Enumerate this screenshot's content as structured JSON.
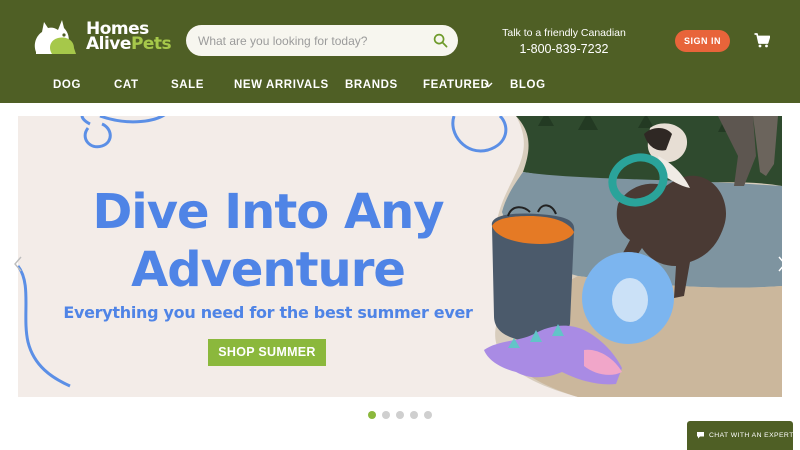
{
  "brand": {
    "name_line1": "Homes",
    "name_line2": "Alive",
    "name_line3": "Pets",
    "color_header": "#4f5f25",
    "color_accent": "#a6c84a"
  },
  "search": {
    "placeholder": "What are you looking for today?",
    "value": "",
    "icon": "search-icon"
  },
  "contact": {
    "line": "Talk to a friendly Canadian",
    "phone": "1-800-839-7232"
  },
  "account": {
    "signin_label": "SIGN IN",
    "signin_color": "#e8643a",
    "cart_icon": "cart-icon"
  },
  "nav": {
    "items": [
      {
        "label": "DOG"
      },
      {
        "label": "CAT"
      },
      {
        "label": "SALE"
      },
      {
        "label": "NEW ARRIVALS"
      },
      {
        "label": "BRANDS"
      },
      {
        "label": "FEATURED"
      },
      {
        "label": "BLOG"
      }
    ],
    "featured_icon": "chevron-down-icon"
  },
  "hero": {
    "headline_line1": "Dive Into Any",
    "headline_line2": "Adventure",
    "subhead": "Everything you need for the best summer ever",
    "cta_label": "SHOP SUMMER",
    "text_color": "#4f84e6",
    "cta_color": "#8bb83c",
    "prev_icon": "chevron-left-icon",
    "next_icon": "chevron-right-icon"
  },
  "carousel": {
    "slide_count": 5,
    "active_index": 0
  },
  "chat": {
    "label": "CHAT WITH AN EXPERT",
    "icon": "chat-bubble-icon"
  }
}
